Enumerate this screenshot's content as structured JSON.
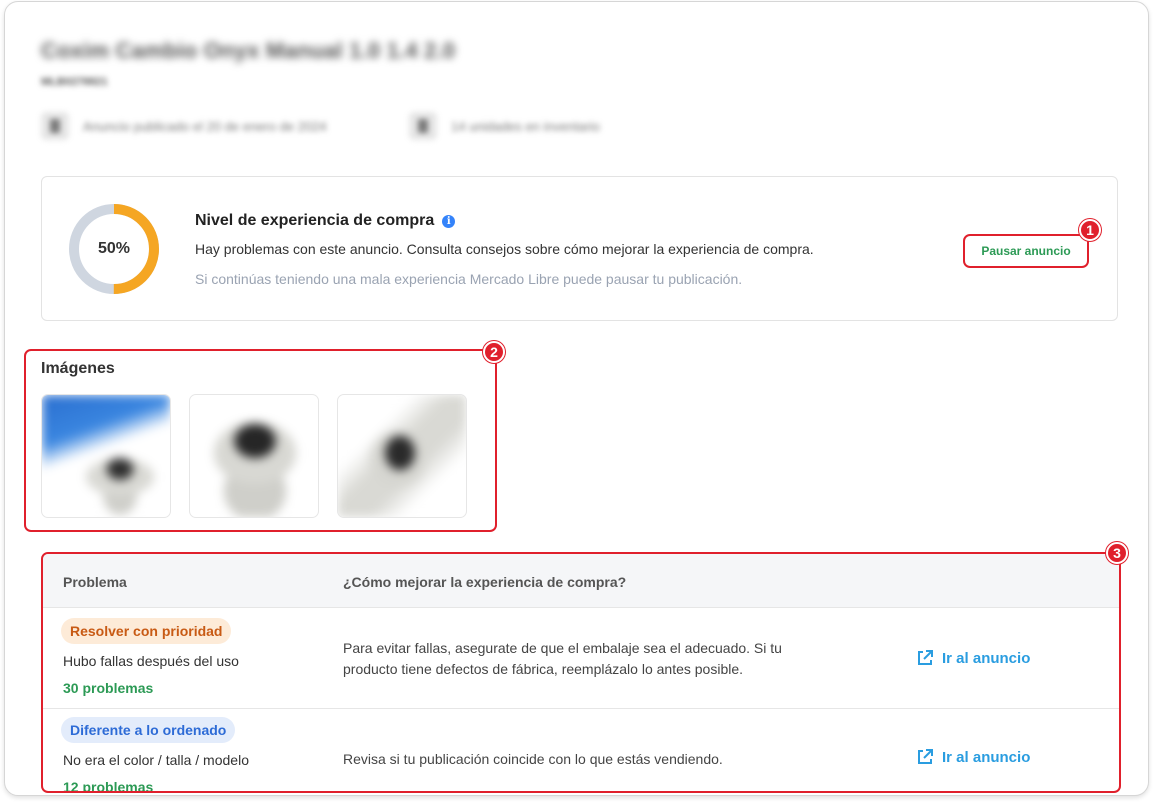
{
  "header": {
    "title": "Coxim Cambio Onyx Manual 1.0 1.4 2.0",
    "item_id": "MLB0278821",
    "published": "Anuncio publicado el 20 de enero de 2024",
    "stock": "14 unidades en inventario"
  },
  "experience": {
    "percent_label": "50%",
    "percent_value": 50,
    "title": "Nivel de experiencia de compra",
    "info_glyph": "i",
    "description": "Hay problemas con este anuncio. Consulta consejos sobre cómo mejorar la experiencia de compra.",
    "warning": "Si continúas teniendo una mala experiencia Mercado Libre puede pausar tu publicación.",
    "pause_label": "Pausar anuncio",
    "colors": {
      "filled": "#f5a623",
      "track": "#cfd6e0"
    }
  },
  "callouts": [
    "1",
    "2",
    "3"
  ],
  "images": {
    "heading": "Imágenes",
    "items": [
      {
        "name": "product-image-1"
      },
      {
        "name": "product-image-2"
      },
      {
        "name": "product-image-3"
      }
    ]
  },
  "problems": {
    "headers": [
      "Problema",
      "¿Cómo mejorar la experiencia de compra?"
    ],
    "rows": [
      {
        "tag": "Resolver con prioridad",
        "description": "Hubo fallas después del uso",
        "count": "30 problemas",
        "tip_line1": "Para evitar fallas, asegurate de que el embalaje sea el adecuado. Si tu",
        "tip_line2": "producto tiene defectos de fábrica, reemplázalo lo antes posible.",
        "link": "Ir al anuncio"
      },
      {
        "tag": "Diferente a lo ordenado",
        "description": "No era el color / talla / modelo",
        "count": "12 problemas",
        "tip_line1": "Revisa si tu publicación coincide con lo que estás vendiendo.",
        "link": "Ir al anuncio"
      }
    ]
  },
  "icons": {
    "info": "info-icon",
    "external_link": "external-link-icon",
    "calendar": "calendar-icon",
    "inventory": "inventory-icon"
  }
}
